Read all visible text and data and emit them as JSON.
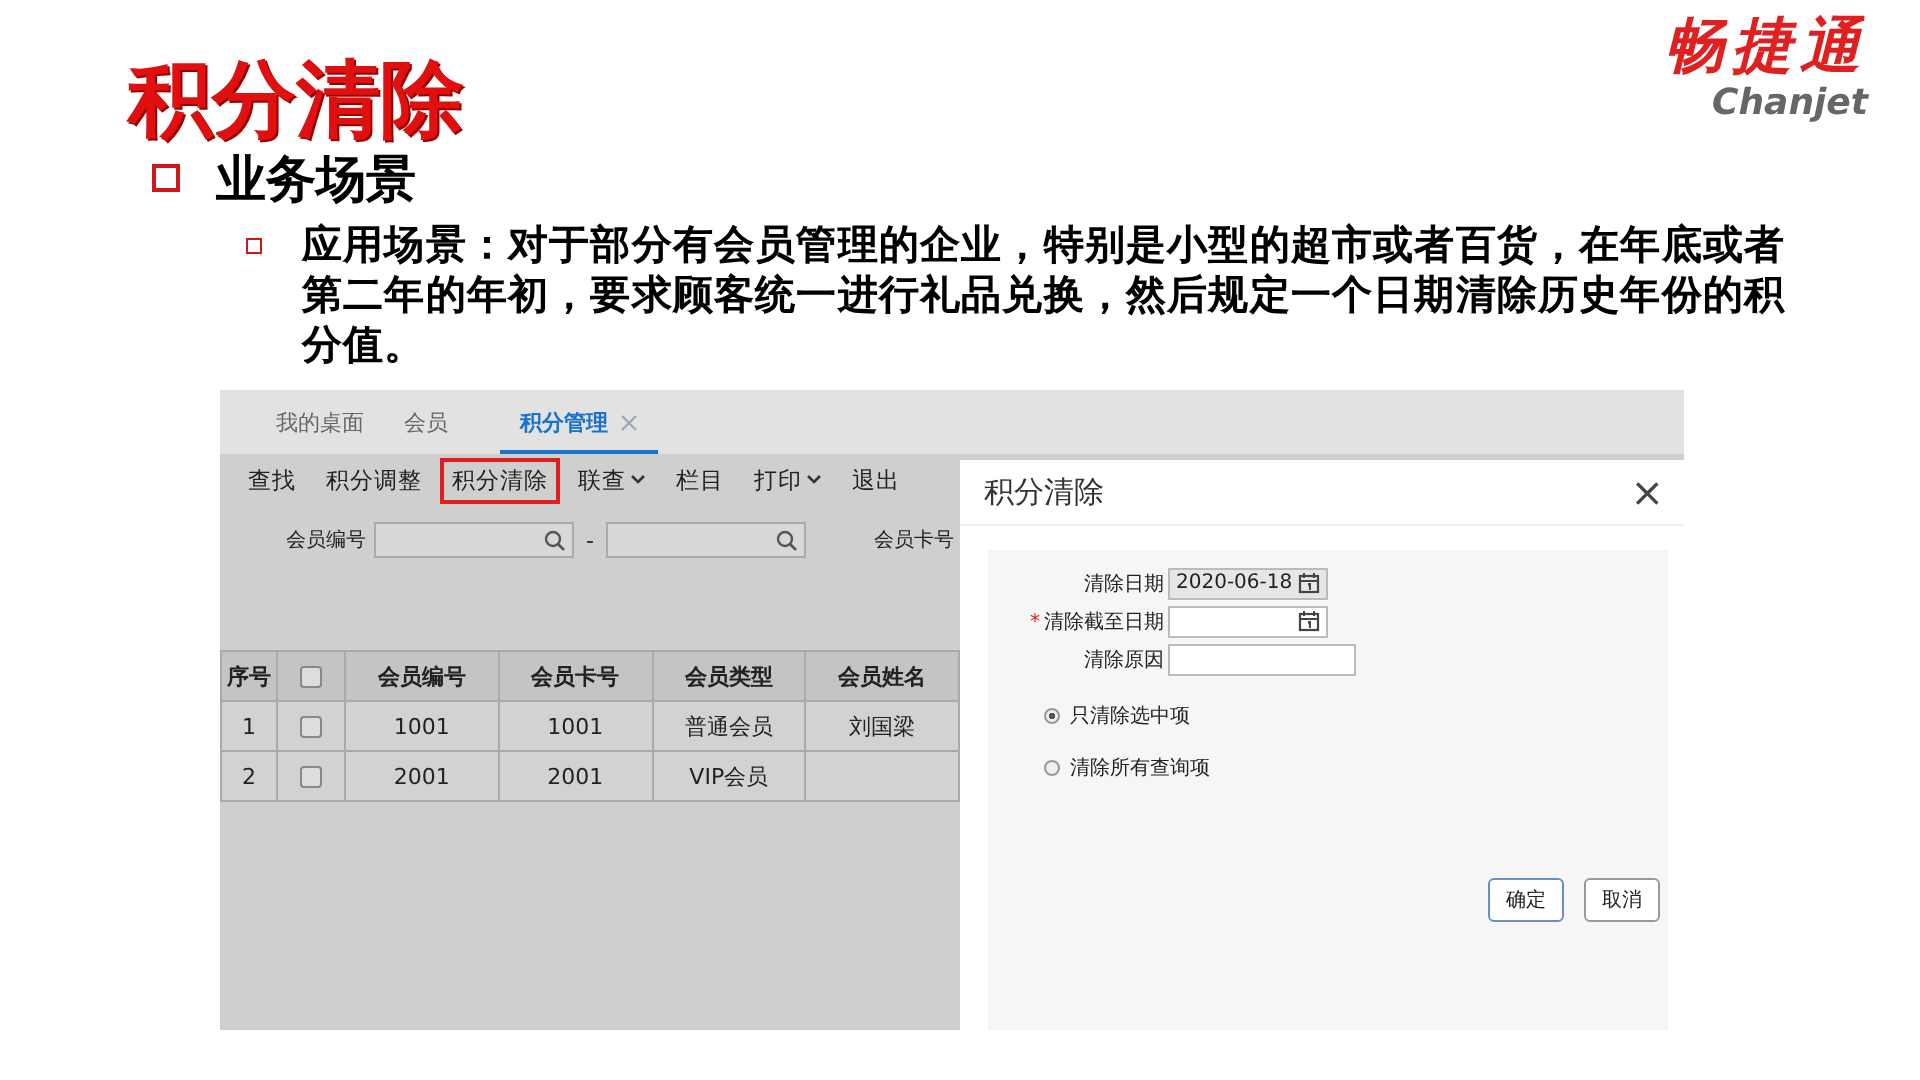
{
  "slide": {
    "title": "积分清除",
    "logo": {
      "name": "畅捷通",
      "subtitle": "Chanjet"
    },
    "heading": "业务场景",
    "paragraph": "应用场景：对于部分有会员管理的企业，特别是小型的超市或者百货，在年底或者第二年的年初，要求顾客统一进行礼品兑换，然后规定一个日期清除历史年份的积分值。"
  },
  "app": {
    "tabs": [
      {
        "label": "我的桌面",
        "selected": false,
        "closable": false
      },
      {
        "label": "会员",
        "selected": false,
        "closable": false
      },
      {
        "label": "积分管理",
        "selected": true,
        "closable": true
      }
    ],
    "toolbar": [
      {
        "label": "查找",
        "highlighted": false,
        "dropdown": false
      },
      {
        "label": "积分调整",
        "highlighted": false,
        "dropdown": false
      },
      {
        "label": "积分清除",
        "highlighted": true,
        "dropdown": false
      },
      {
        "label": "联查",
        "highlighted": false,
        "dropdown": true
      },
      {
        "label": "栏目",
        "highlighted": false,
        "dropdown": false
      },
      {
        "label": "打印",
        "highlighted": false,
        "dropdown": true
      },
      {
        "label": "退出",
        "highlighted": false,
        "dropdown": false
      }
    ],
    "filter": {
      "label": "会员编号",
      "separator": "-",
      "next_label": "会员卡号"
    },
    "table": {
      "columns": [
        "序号",
        "",
        "会员编号",
        "会员卡号",
        "会员类型",
        "会员姓名"
      ],
      "header_checked": false,
      "rows": [
        {
          "cells": [
            "1",
            "",
            "1001",
            "1001",
            "普通会员",
            "刘国梁"
          ],
          "checked": false
        },
        {
          "cells": [
            "2",
            "",
            "2001",
            "2001",
            "VIP会员",
            ""
          ],
          "checked": false
        }
      ]
    },
    "dialog": {
      "title": "积分清除",
      "close": "×",
      "fields": [
        {
          "label": "清除日期",
          "value": "2020-06-18",
          "readonly": true,
          "calendar": true
        },
        {
          "label": "清除截至日期",
          "required_mark": "*",
          "readonly": false,
          "calendar": true
        },
        {
          "label": "清除原因",
          "readonly": false,
          "calendar": false
        }
      ],
      "options": [
        {
          "label": "只清除选中项",
          "selected": true
        },
        {
          "label": "清除所有查询项",
          "selected": false
        }
      ],
      "buttons": [
        {
          "label": "确定",
          "primary": true
        },
        {
          "label": "取消",
          "primary": false
        }
      ]
    }
  }
}
